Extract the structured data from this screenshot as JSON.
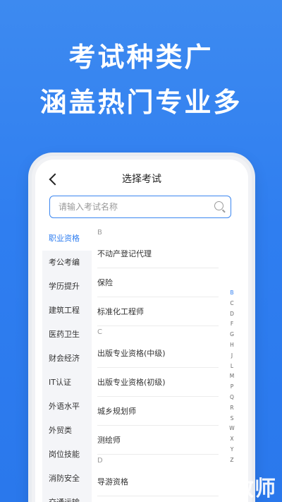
{
  "headline": {
    "line1": "考试种类广",
    "line2": "涵盖热门专业多"
  },
  "screen": {
    "title": "选择考试",
    "search_placeholder": "请输入考试名称"
  },
  "sidebar": {
    "items": [
      {
        "label": "职业资格",
        "active": true
      },
      {
        "label": "考公考编"
      },
      {
        "label": "学历提升"
      },
      {
        "label": "建筑工程"
      },
      {
        "label": "医药卫生"
      },
      {
        "label": "财会经济"
      },
      {
        "label": "IT认证"
      },
      {
        "label": "外语水平"
      },
      {
        "label": "外贸类"
      },
      {
        "label": "岗位技能"
      },
      {
        "label": "消防安全"
      },
      {
        "label": "交通运输"
      }
    ]
  },
  "list": {
    "groups": [
      {
        "letter": "B",
        "items": [
          "不动产登记代理",
          "保险",
          "标准化工程师"
        ]
      },
      {
        "letter": "C",
        "items": [
          "出版专业资格(中级)",
          "出版专业资格(初级)",
          "城乡规划师",
          "测绘师"
        ]
      },
      {
        "letter": "D",
        "items": [
          "导游资格"
        ]
      }
    ]
  },
  "index_bar": {
    "letters": [
      "B",
      "C",
      "D",
      "F",
      "G",
      "H",
      "J",
      "L",
      "M",
      "P",
      "Q",
      "R",
      "S",
      "W",
      "X",
      "Y",
      "Z"
    ],
    "active": "B"
  },
  "watermark": "教师"
}
